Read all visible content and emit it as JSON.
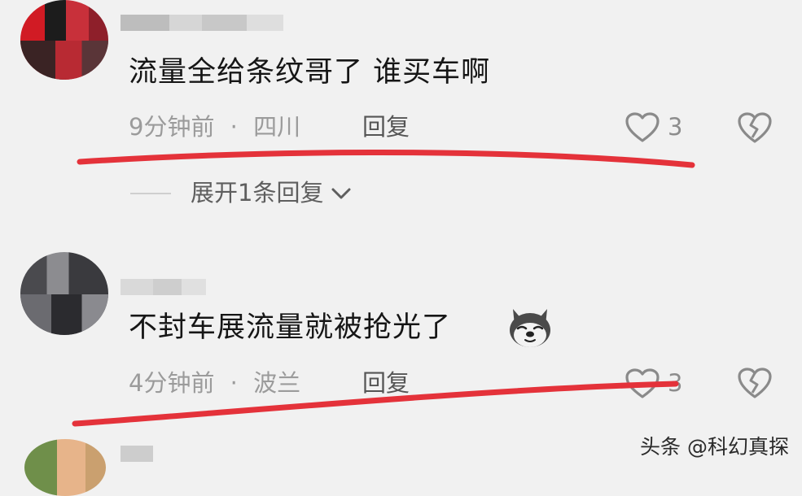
{
  "comments": [
    {
      "text": "流量全给条纹哥了  谁买车啊",
      "time": "9分钟前",
      "separator": "·",
      "location": "四川",
      "reply_label": "回复",
      "like_count": "3",
      "expand_label": "展开1条回复"
    },
    {
      "text": "不封车展流量就被抢光了",
      "time": "4分钟前",
      "separator": "·",
      "location": "波兰",
      "reply_label": "回复",
      "like_count": "3"
    }
  ],
  "icons": {
    "like": "heart-outline-icon",
    "dislike": "broken-heart-icon",
    "expand": "chevron-down-icon",
    "emoji": "dog-face-emoji"
  },
  "colors": {
    "annotation_underline": "#e4323a",
    "background": "#f1f1f1"
  },
  "watermark": "头条 @科幻真探"
}
